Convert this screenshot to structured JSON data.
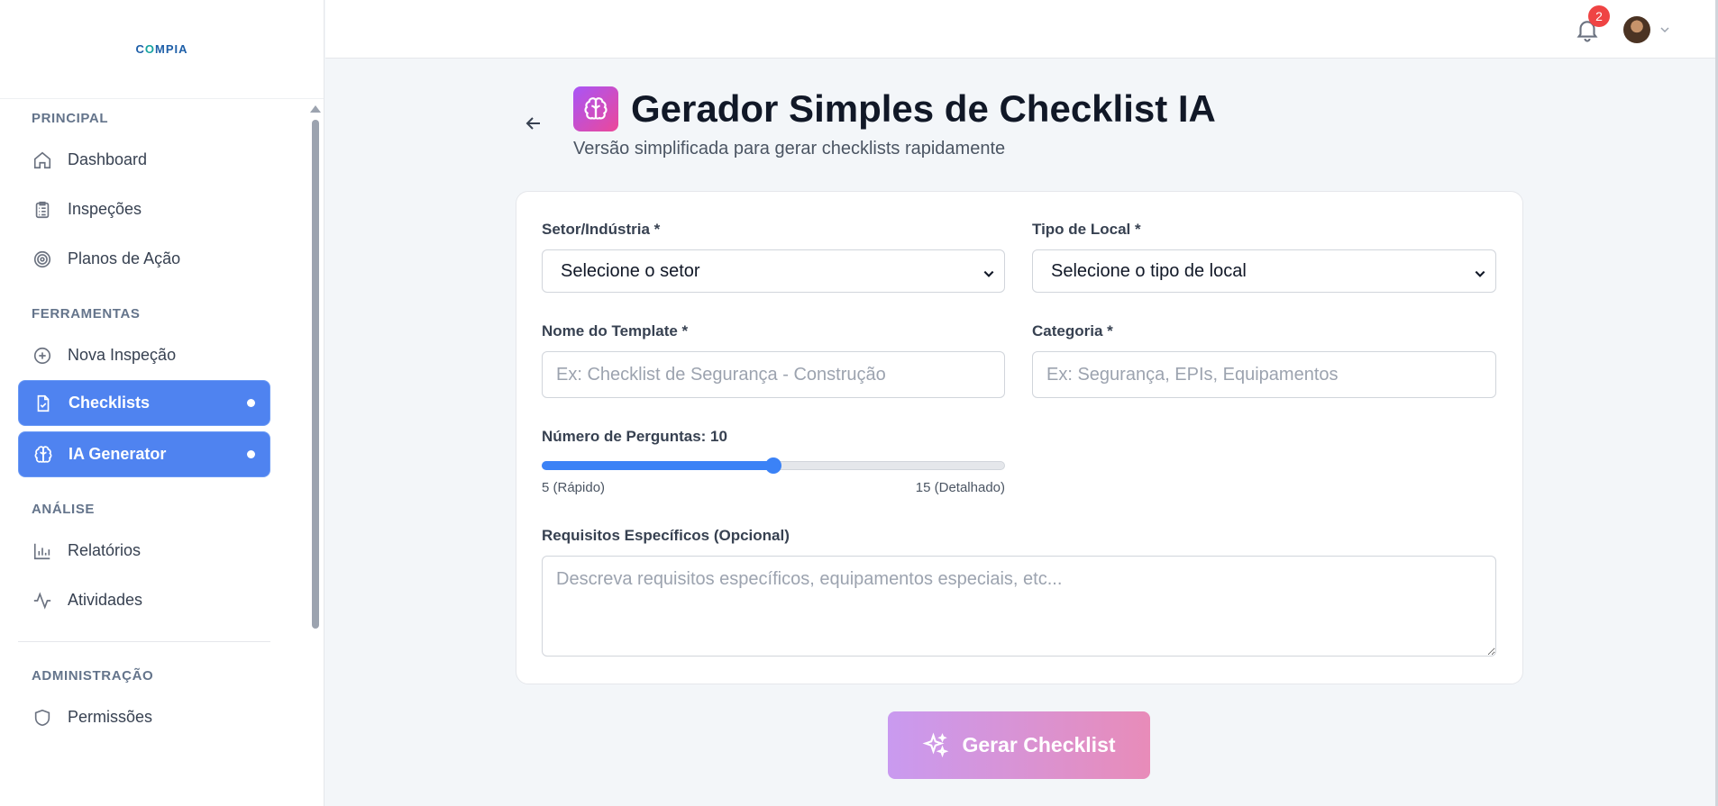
{
  "brand": {
    "name_part1": "C",
    "name_o": "O",
    "name_part2": "MPIA"
  },
  "sidebar": {
    "sections": [
      {
        "title": "PRINCIPAL"
      },
      {
        "title": "FERRAMENTAS"
      },
      {
        "title": "ANÁLISE"
      },
      {
        "title": "ADMINISTRAÇÃO"
      }
    ],
    "items": [
      {
        "label": "Dashboard",
        "icon": "home-icon"
      },
      {
        "label": "Inspeções",
        "icon": "clipboard-list-icon"
      },
      {
        "label": "Planos de Ação",
        "icon": "target-icon"
      },
      {
        "label": "Nova Inspeção",
        "icon": "plus-circle-icon"
      },
      {
        "label": "Checklists",
        "icon": "file-check-icon",
        "active": true
      },
      {
        "label": "IA Generator",
        "icon": "brain-icon",
        "active": true
      },
      {
        "label": "Relatórios",
        "icon": "bar-chart-icon"
      },
      {
        "label": "Atividades",
        "icon": "activity-icon"
      },
      {
        "label": "Permissões",
        "icon": "shield-icon"
      }
    ]
  },
  "topbar": {
    "notification_count": "2"
  },
  "header": {
    "title": "Gerador Simples de Checklist IA",
    "subtitle": "Versão simplificada para gerar checklists rapidamente"
  },
  "form": {
    "sector": {
      "label": "Setor/Indústria *",
      "value": "Selecione o setor"
    },
    "location_type": {
      "label": "Tipo de Local *",
      "value": "Selecione o tipo de local"
    },
    "template_name": {
      "label": "Nome do Template *",
      "placeholder": "Ex: Checklist de Segurança - Construção",
      "value": ""
    },
    "category": {
      "label": "Categoria *",
      "placeholder": "Ex: Segurança, EPIs, Equipamentos",
      "value": ""
    },
    "question_count": {
      "label": "Número de Perguntas: 10",
      "value": 10,
      "min": 5,
      "max": 15,
      "min_label": "5 (Rápido)",
      "max_label": "15 (Detalhado)"
    },
    "requirements": {
      "label": "Requisitos Específicos (Opcional)",
      "placeholder": "Descreva requisitos específicos, equipamentos especiais, etc...",
      "value": ""
    }
  },
  "actions": {
    "generate_label": "Gerar Checklist"
  },
  "colors": {
    "accent": "#4f83f0",
    "title_icon_from": "#a855f7",
    "title_icon_to": "#ec4899",
    "badge": "#ef4444"
  }
}
